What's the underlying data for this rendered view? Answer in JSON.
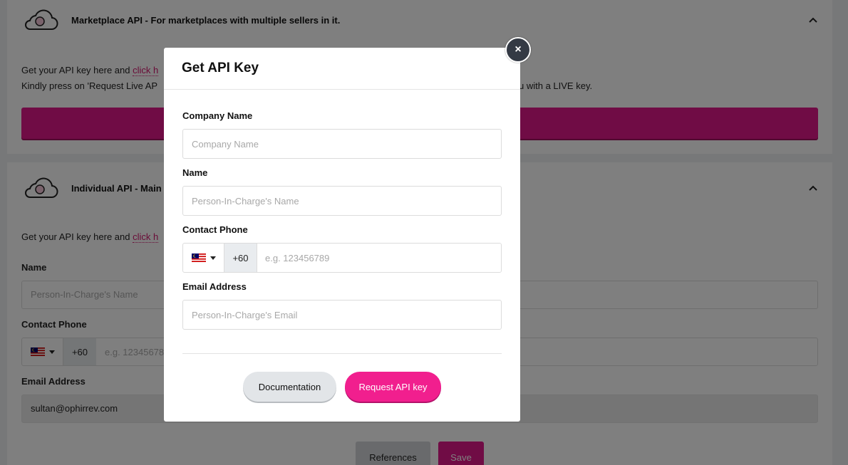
{
  "background": {
    "card1": {
      "title": "Marketplace API - For marketplaces with multiple sellers in it.",
      "info_prefix": "Get your API key here and ",
      "info_link": "click h",
      "info_line2_left": "Kindly press on 'Request Live AP",
      "info_line2_right": "u with a LIVE key."
    },
    "card2": {
      "title": "Individual API - Main",
      "info_prefix": "Get your API key here and ",
      "info_link": "click h",
      "name_label": "Name",
      "name_placeholder": "Person-In-Charge's Name",
      "phone_label": "Contact Phone",
      "dial_code": "+60",
      "phone_placeholder": "e.g. 12345678",
      "email_label": "Email Address",
      "email_value": "sultan@ophirrev.com",
      "references_button": "References",
      "save_button": "Save"
    }
  },
  "modal": {
    "title": "Get API Key",
    "close_label": "×",
    "company_label": "Company Name",
    "company_placeholder": "Company Name",
    "name_label": "Name",
    "name_placeholder": "Person-In-Charge's Name",
    "phone_label": "Contact Phone",
    "dial_code": "+60",
    "phone_placeholder": "e.g. 123456789",
    "email_label": "Email Address",
    "email_placeholder": "Person-In-Charge's Email",
    "documentation_button": "Documentation",
    "request_button": "Request API key"
  },
  "icons": {
    "cloud": "cloud-icon",
    "chevron": "chevron-up-icon",
    "flag": "malaysia-flag-icon",
    "close": "close-icon"
  },
  "colors": {
    "accent": "#e0198a",
    "request_button": "#f11f8e",
    "close_button": "#343a44"
  }
}
